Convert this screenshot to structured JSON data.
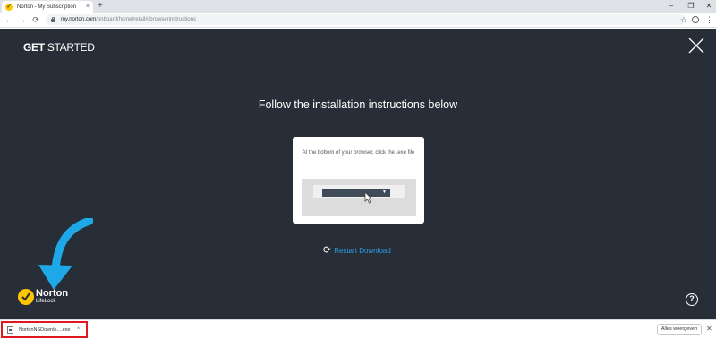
{
  "browser": {
    "tab": {
      "title": "Norton - My Subscription",
      "close": "×"
    },
    "new_tab": "+",
    "window_controls": {
      "minimize": "–",
      "restore": "❐",
      "close": "✕"
    },
    "nav": {
      "back": "←",
      "forward": "→",
      "reload": "⟳"
    },
    "url": {
      "host": "my.norton.com",
      "path": "/onboard/home/retail#/browserinstructions"
    },
    "bookmark": "☆",
    "menu": "⋮"
  },
  "page": {
    "brand_bold": "GET",
    "brand_rest": " STARTED",
    "heading": "Follow the installation instructions below",
    "card_text": "At the bottom of your browser, click the .exe file",
    "dropdown_arrow": "▼",
    "restart_icon": "⟳",
    "restart_label": "Restart Download",
    "logo_name": "Norton",
    "logo_sub": "LifeLock",
    "help": "?"
  },
  "download_shelf": {
    "file_name": "NortonNSDownlo....exe",
    "chevron": "^",
    "show_all": "Alles weergeven",
    "close": "✕"
  },
  "colors": {
    "page_bg": "#272e37",
    "accent_link": "#2e9de6",
    "norton_yellow": "#ffc700",
    "arrow_blue": "#1fa8e8",
    "highlight_red": "#e0191f"
  },
  "icons": {
    "favicon": "norton-favicon",
    "lock": "lock-icon",
    "close_page": "close-icon",
    "restart": "refresh-icon",
    "big_arrow": "arrow-down-left-icon",
    "help": "help-icon",
    "file": "file-icon"
  }
}
